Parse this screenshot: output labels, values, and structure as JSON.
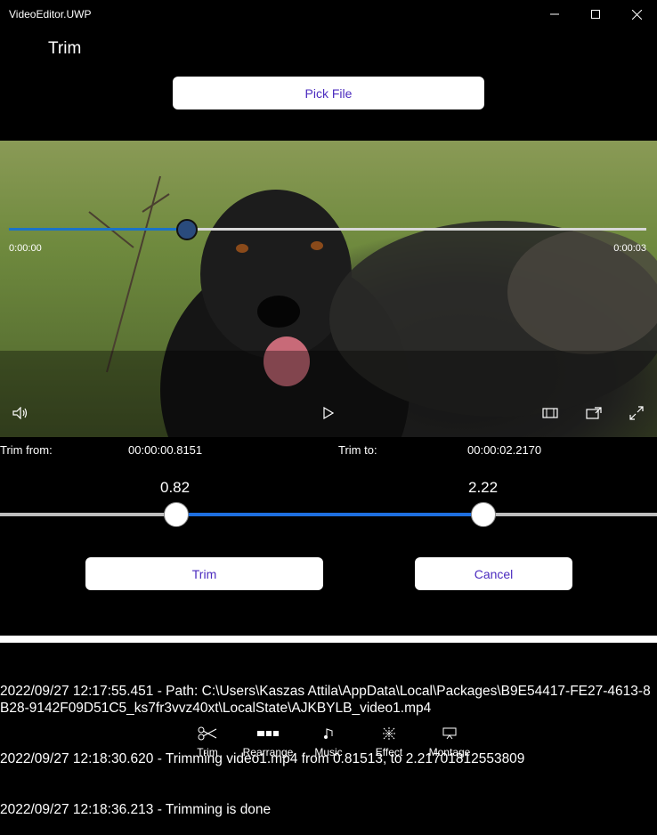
{
  "window": {
    "title": "VideoEditor.UWP"
  },
  "page": {
    "title": "Trim"
  },
  "pick_file_label": "Pick File",
  "player": {
    "time_current": "0:00:00",
    "time_total": "0:00:03",
    "progress": 0.27
  },
  "trim": {
    "from_label": "Trim from:",
    "from_value": "00:00:00.8151",
    "to_label": "Trim to:",
    "to_value": "00:00:02.2170",
    "range_low": "0.82",
    "range_high": "2.22",
    "trim_button": "Trim",
    "cancel_button": "Cancel"
  },
  "log": {
    "lines": [
      "2022/09/27 12:17:55.451 - Path: C:\\Users\\Kaszas Attila\\AppData\\Local\\Packages\\B9E54417-FE27-4613-8B28-9142F09D51C5_ks7fr3vvz40xt\\LocalState\\AJKBYLB_video1.mp4",
      "2022/09/27 12:18:30.620 - Trimming video1.mp4 from 0.81513, to 2.21701812553809",
      "2022/09/27 12:18:36.213 - Trimming is done"
    ]
  },
  "nav": [
    {
      "label": "Trim",
      "icon": "scissors-icon"
    },
    {
      "label": "Rearrange",
      "icon": "rearrange-icon"
    },
    {
      "label": "Music",
      "icon": "music-icon"
    },
    {
      "label": "Effect",
      "icon": "effect-icon"
    },
    {
      "label": "Montage",
      "icon": "montage-icon"
    }
  ]
}
